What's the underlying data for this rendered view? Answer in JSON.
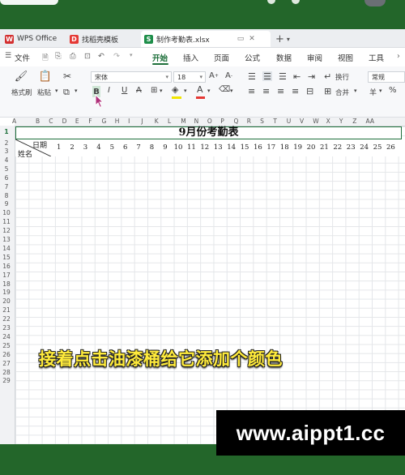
{
  "tabs": [
    {
      "label": "WPS Office",
      "icon": "wps-logo-icon"
    },
    {
      "label": "找稻壳模板",
      "icon": "docer-icon"
    },
    {
      "label": "制作考勤表.xlsx",
      "icon": "sheet-icon",
      "active": true
    }
  ],
  "menu": {
    "file": "文件",
    "items": [
      "开始",
      "插入",
      "页面",
      "公式",
      "数据",
      "审阅",
      "视图",
      "工具"
    ],
    "active": "开始"
  },
  "ribbon": {
    "format_painter": "格式刷",
    "paste": "粘贴",
    "font_name": "宋体",
    "font_size": "18",
    "wrap_text": "换行",
    "merge": "合并",
    "number_format": "常规",
    "currency_symbol": "羊"
  },
  "sheet": {
    "columns": [
      "A",
      "B",
      "C",
      "D",
      "E",
      "F",
      "G",
      "H",
      "I",
      "J",
      "K",
      "L",
      "M",
      "N",
      "O",
      "P",
      "Q",
      "R",
      "S",
      "T",
      "U",
      "V",
      "W",
      "X",
      "Y",
      "Z",
      "AA"
    ],
    "rows": [
      "1",
      "2",
      "3",
      "4",
      "5",
      "6",
      "7",
      "8",
      "9",
      "10",
      "11",
      "12",
      "13",
      "14",
      "15",
      "16",
      "17",
      "18",
      "19",
      "20",
      "21",
      "22",
      "23",
      "24",
      "25",
      "26",
      "27",
      "28",
      "29"
    ],
    "title": "9月份考勤表",
    "date_label": "日期",
    "name_label": "姓名",
    "days": [
      "1",
      "2",
      "3",
      "4",
      "5",
      "6",
      "7",
      "8",
      "9",
      "10",
      "11",
      "12",
      "13",
      "14",
      "15",
      "16",
      "17",
      "18",
      "19",
      "20",
      "21",
      "22",
      "23",
      "24",
      "25",
      "26"
    ]
  },
  "caption": "接着点击油漆桶给它添加个颜色",
  "watermark": "www.aippt1.cc",
  "colors": {
    "brand_green": "#23662a",
    "caption_yellow": "#ffeb3b"
  }
}
